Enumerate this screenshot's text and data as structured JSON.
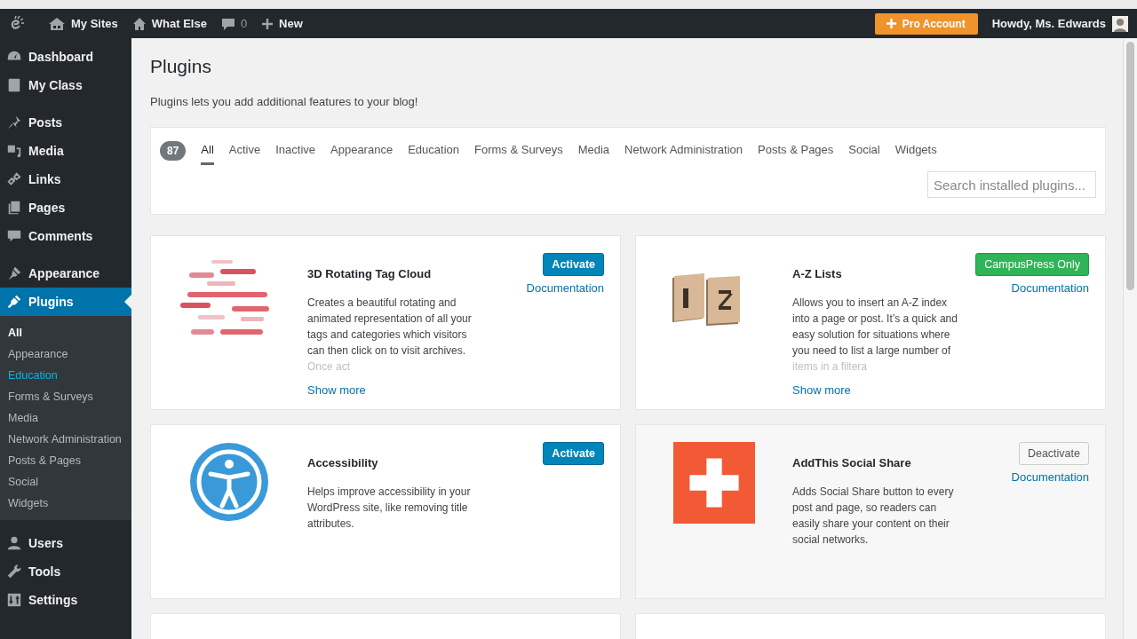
{
  "admin_bar": {
    "items": [
      {
        "label": "My Sites"
      },
      {
        "label": "What Else"
      },
      {
        "label": "0"
      },
      {
        "label": "New"
      }
    ],
    "pro_button": "Pro Account",
    "greeting": "Howdy, Ms. Edwards"
  },
  "sidebar": {
    "groups": [
      [
        {
          "label": "Dashboard",
          "selected": false
        },
        {
          "label": "My Class",
          "selected": false
        }
      ],
      [
        {
          "label": "Posts",
          "selected": false
        },
        {
          "label": "Media",
          "selected": false
        },
        {
          "label": "Links",
          "selected": false
        },
        {
          "label": "Pages",
          "selected": false
        },
        {
          "label": "Comments",
          "selected": false
        }
      ],
      [
        {
          "label": "Appearance",
          "selected": false
        },
        {
          "label": "Plugins",
          "selected": true,
          "submenu": [
            {
              "label": "All",
              "current": true,
              "hovered": false
            },
            {
              "label": "Appearance",
              "current": false,
              "hovered": false
            },
            {
              "label": "Education",
              "current": false,
              "hovered": true
            },
            {
              "label": "Forms & Surveys",
              "current": false,
              "hovered": false
            },
            {
              "label": "Media",
              "current": false,
              "hovered": false
            },
            {
              "label": "Network Administration",
              "current": false,
              "hovered": false
            },
            {
              "label": "Posts & Pages",
              "current": false,
              "hovered": false
            },
            {
              "label": "Social",
              "current": false,
              "hovered": false
            },
            {
              "label": "Widgets",
              "current": false,
              "hovered": false
            }
          ]
        }
      ],
      [
        {
          "label": "Users",
          "selected": false
        },
        {
          "label": "Tools",
          "selected": false
        },
        {
          "label": "Settings",
          "selected": false
        }
      ]
    ]
  },
  "page": {
    "title": "Plugins",
    "intro": "Plugins lets you add additional features to your blog!"
  },
  "filters": {
    "count": "87",
    "tabs": [
      {
        "label": "All",
        "selected": true
      },
      {
        "label": "Active",
        "selected": false
      },
      {
        "label": "Inactive",
        "selected": false
      },
      {
        "label": "Appearance",
        "selected": false
      },
      {
        "label": "Education",
        "selected": false
      },
      {
        "label": "Forms & Surveys",
        "selected": false
      },
      {
        "label": "Media",
        "selected": false
      },
      {
        "label": "Network Administration",
        "selected": false
      },
      {
        "label": "Posts & Pages",
        "selected": false
      },
      {
        "label": "Social",
        "selected": false
      },
      {
        "label": "Widgets",
        "selected": false
      }
    ],
    "search": {
      "placeholder": "Search installed plugins..."
    }
  },
  "plugins": [
    {
      "kind": "picture",
      "name": "3D Rotating Tag Cloud",
      "description": "Creates a beautiful rotating and animated representation of all your tags and categories which visitors can then click on to visit archives. Once act",
      "show_more": "Show more",
      "button": {
        "kind": "activate",
        "label": "Activate"
      },
      "documentation": "Documentation"
    },
    {
      "kind": "picture",
      "name": "A-Z Lists",
      "description": "Allows you to insert an A-Z index into a page or post. It’s a quick and easy solution for situations where you need to list a large number of items in a filtera",
      "show_more": "Show more",
      "button": {
        "kind": "exclusive",
        "label": "CampusPress Only"
      },
      "documentation": "Documentation"
    },
    {
      "kind": "icon",
      "name": "Accessibility",
      "description": "Helps improve accessibility in your WordPress site, like removing title attributes.",
      "button": {
        "kind": "activate",
        "label": "Activate"
      }
    },
    {
      "kind": "icon",
      "name": "AddThis Social Share",
      "description": "Adds Social Share button to every post and page, so readers can easily share your content on their social networks.",
      "button": {
        "kind": "deactivate",
        "label": "Deactivate"
      },
      "documentation": "Documentation"
    }
  ]
}
